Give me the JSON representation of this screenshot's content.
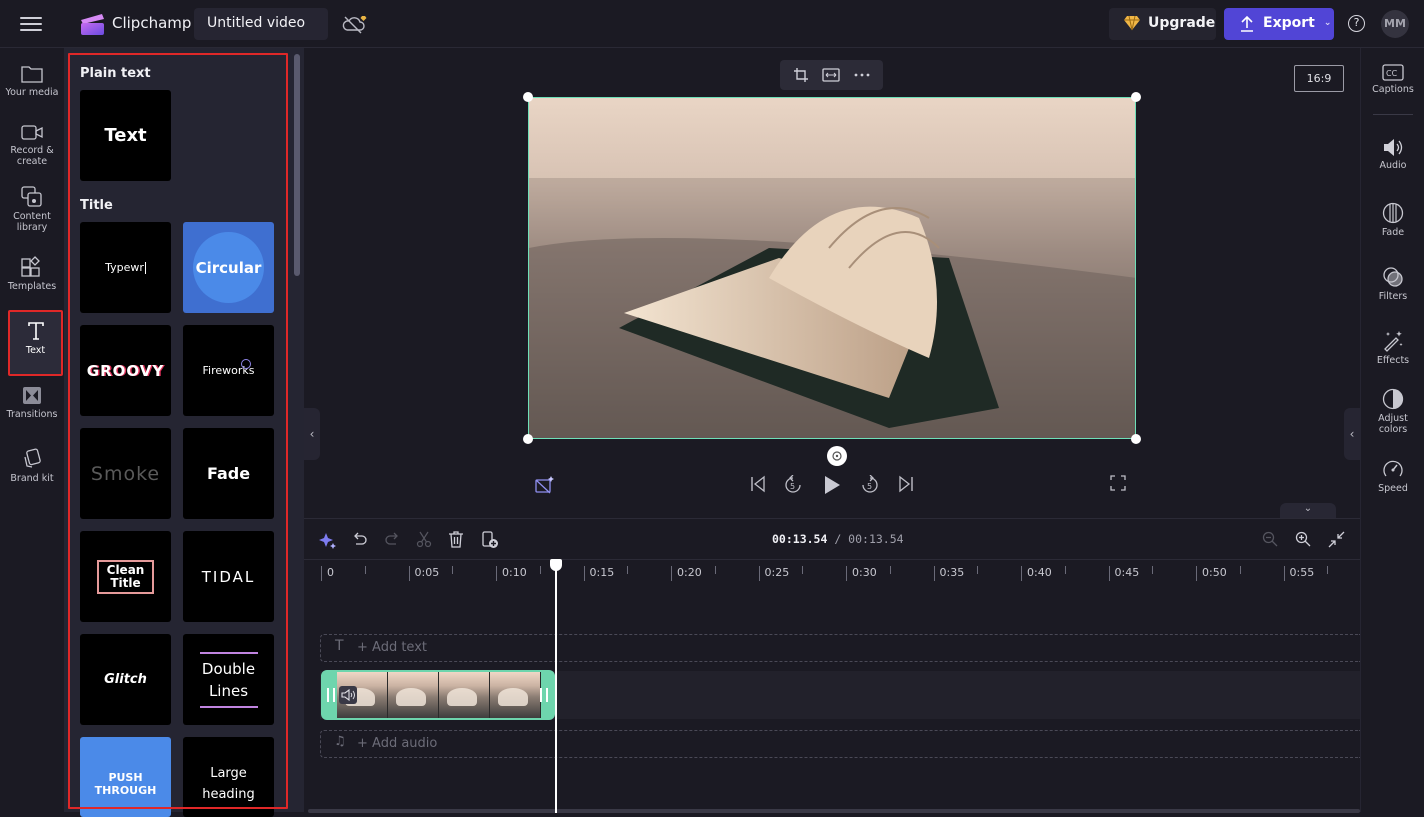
{
  "app": {
    "brand": "Clipchamp",
    "project_title": "Untitled video",
    "upgrade_label": "Upgrade",
    "export_label": "Export",
    "help_label": "?",
    "avatar_initials": "MM",
    "accent_color": "#5145d6",
    "selection_color": "#6ee0b8",
    "highlight_color": "#e02828"
  },
  "left_nav": {
    "items": [
      {
        "label": "Your media",
        "icon": "folder-icon"
      },
      {
        "label": "Record &",
        "label2": "create",
        "icon": "camera-icon"
      },
      {
        "label": "Content",
        "label2": "library",
        "icon": "content-library-icon"
      },
      {
        "label": "Templates",
        "icon": "templates-icon"
      },
      {
        "label": "Text",
        "icon": "text-icon",
        "active": true
      },
      {
        "label": "Transitions",
        "icon": "transitions-icon"
      },
      {
        "label": "Brand kit",
        "icon": "brand-kit-icon"
      }
    ]
  },
  "text_panel": {
    "sections": [
      {
        "title": "Plain text",
        "tiles": [
          "Text"
        ]
      },
      {
        "title": "Title",
        "tiles": [
          "Typewr",
          "Circular",
          "GROOVY",
          "Fireworks",
          "Smoke",
          "Fade",
          "Clean Title",
          "TIDAL",
          "Glitch",
          "Double Lines",
          "PUSH THROUGH",
          "Large heading"
        ]
      }
    ],
    "tile_labels": {
      "text": "Text",
      "typewriter": "Typewr",
      "circular": "Circular",
      "groovy": "GROOVY",
      "fireworks": "Fireworks",
      "smoke": "Smoke",
      "fade": "Fade",
      "clean_title_1": "Clean",
      "clean_title_2": "Title",
      "tidal": "TIDAL",
      "glitch": "Glitch",
      "double_lines_1": "Double",
      "double_lines_2": "Lines",
      "push_through": "PUSH THROUGH",
      "large_heading_1": "Large",
      "large_heading_2": "heading"
    }
  },
  "preview": {
    "aspect_ratio": "16:9",
    "floating_toolbar": [
      "crop-icon",
      "fit-icon",
      "more-icon"
    ]
  },
  "right_panel": {
    "items": [
      {
        "label": "Captions",
        "icon": "captions-icon"
      },
      {
        "label": "Audio",
        "icon": "speaker-icon"
      },
      {
        "label": "Fade",
        "icon": "fade-icon"
      },
      {
        "label": "Filters",
        "icon": "filters-icon"
      },
      {
        "label": "Effects",
        "icon": "magic-wand-icon"
      },
      {
        "label": "Adjust",
        "label2": "colors",
        "icon": "adjust-colors-icon"
      },
      {
        "label": "Speed",
        "icon": "speedometer-icon"
      }
    ]
  },
  "timeline": {
    "current_time": "00:13.54",
    "separator": " / ",
    "total_time": "00:13.54",
    "ruler_labels": [
      "0",
      "0:05",
      "0:10",
      "0:15",
      "0:20",
      "0:25",
      "0:30",
      "0:35",
      "0:40",
      "0:45",
      "0:50",
      "0:55"
    ],
    "add_text_label": "+ Add text",
    "add_audio_label": "+ Add audio"
  }
}
